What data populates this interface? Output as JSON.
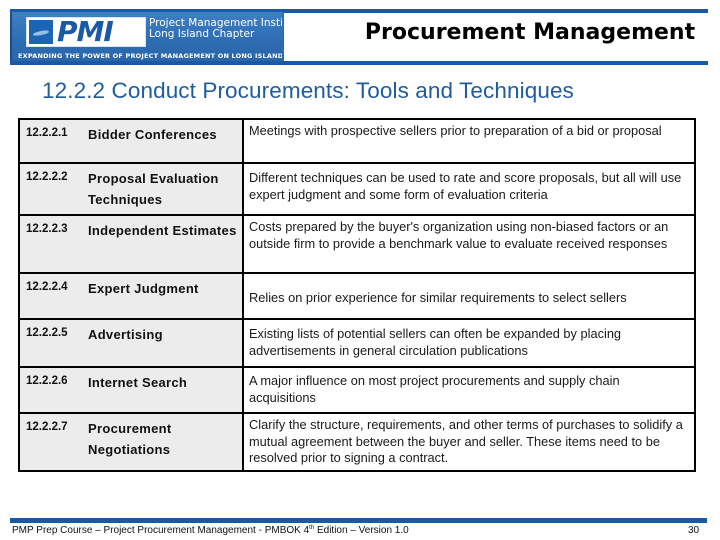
{
  "header": {
    "logo_text": "PMI",
    "org_name_line1": "Project Management Institute",
    "org_name_line2": "Long Island Chapter",
    "tagline": "Expanding the Power of Project Management on Long Island",
    "deck_title": "Procurement Management"
  },
  "slide": {
    "heading": "12.2.2 Conduct Procurements:  Tools and Techniques"
  },
  "table": {
    "rows": [
      {
        "number": "12.2.2.1",
        "name": "Bidder Conferences",
        "description": "Meetings with prospective sellers prior to preparation of a bid or proposal"
      },
      {
        "number": "12.2.2.2",
        "name": "Proposal Evaluation Techniques",
        "description": "Different techniques can be used to rate and score proposals, but all will use expert judgment and some form of evaluation criteria"
      },
      {
        "number": "12.2.2.3",
        "name": "Independent Estimates",
        "description": "Costs prepared by the buyer's organization using non-biased factors or an outside firm to provide a benchmark value to evaluate received responses"
      },
      {
        "number": "12.2.2.4",
        "name": "Expert Judgment",
        "description": "Relies on prior experience for similar requirements to select sellers"
      },
      {
        "number": "12.2.2.5",
        "name": "Advertising",
        "description": "Existing lists of potential sellers can often be expanded by placing advertisements in general circulation publications"
      },
      {
        "number": "12.2.2.6",
        "name": "Internet Search",
        "description": "A major influence on most project procurements and supply chain acquisitions"
      },
      {
        "number": "12.2.2.7",
        "name": "Procurement Negotiations",
        "description": "Clarify the structure, requirements, and other terms of purchases to solidify a mutual agreement between the buyer and seller. These items need to be resolved prior to signing a contract."
      }
    ]
  },
  "footer": {
    "text_before_sup": "PMP Prep Course – Project Procurement Management - PMBOK 4",
    "sup": "th",
    "text_after_sup": " Edition – Version 1.0",
    "page_number": "30"
  },
  "colors": {
    "brand_blue": "#1a5aa5",
    "heading_blue": "#1f5c9e",
    "left_cell_bg": "#ececec"
  }
}
